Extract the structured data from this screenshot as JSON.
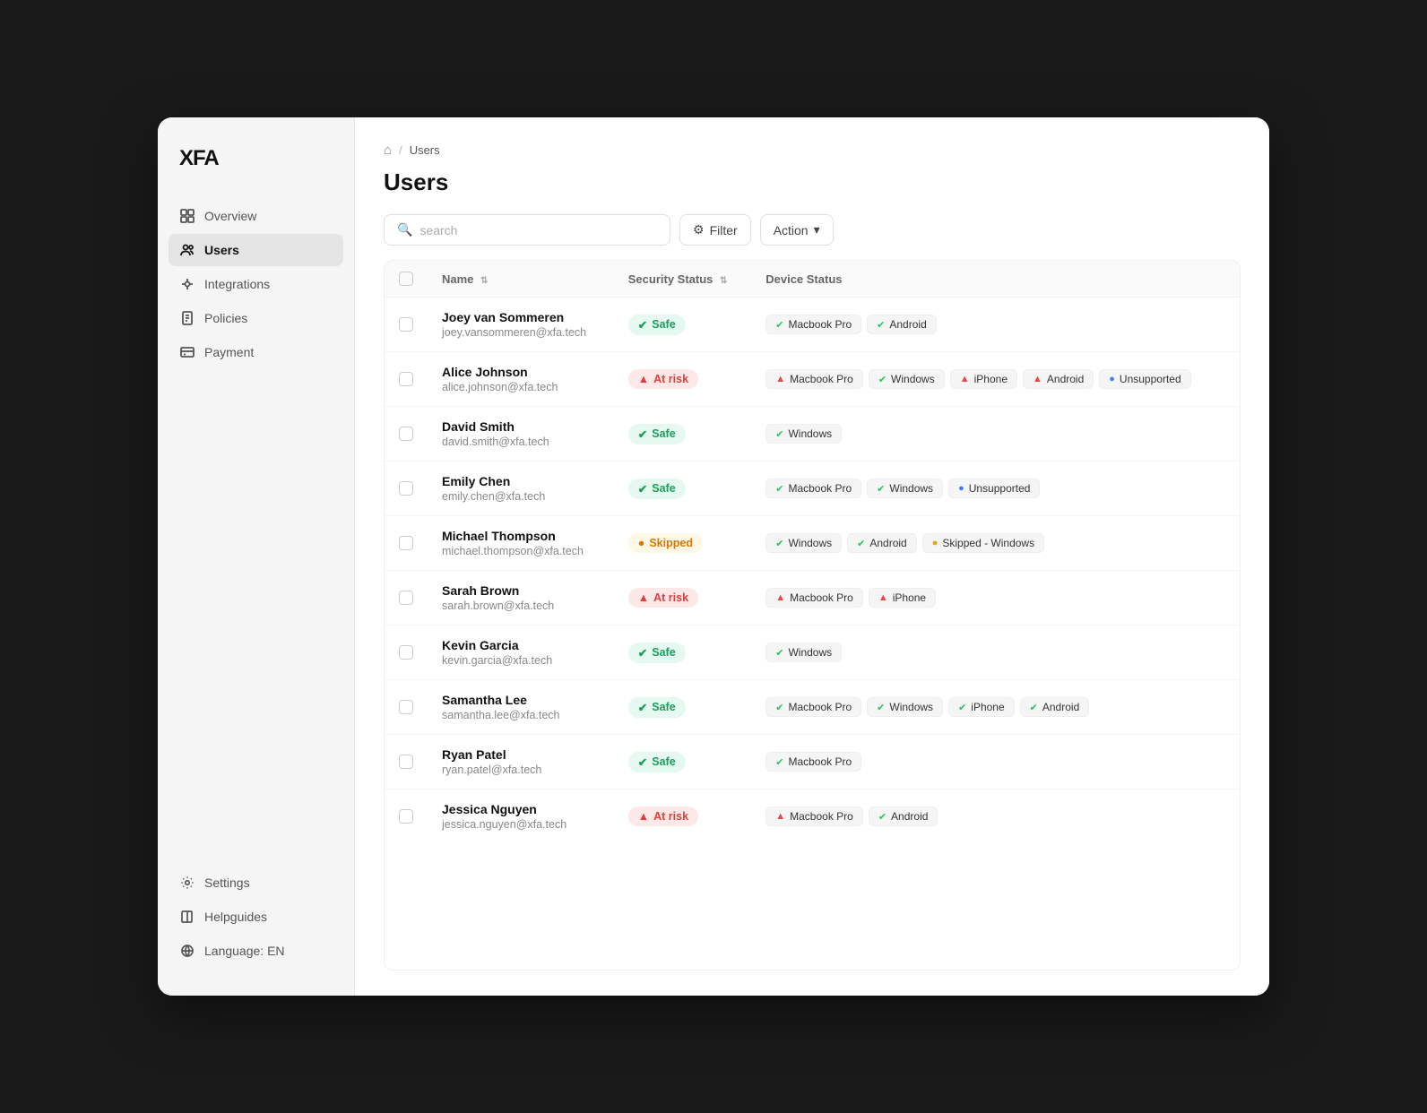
{
  "app": {
    "logo": "XFA"
  },
  "sidebar": {
    "nav_items": [
      {
        "id": "overview",
        "label": "Overview",
        "icon": "grid"
      },
      {
        "id": "users",
        "label": "Users",
        "icon": "users",
        "active": true
      },
      {
        "id": "integrations",
        "label": "Integrations",
        "icon": "integrations"
      },
      {
        "id": "policies",
        "label": "Policies",
        "icon": "policies"
      },
      {
        "id": "payment",
        "label": "Payment",
        "icon": "payment"
      }
    ],
    "bottom_items": [
      {
        "id": "settings",
        "label": "Settings",
        "icon": "settings"
      },
      {
        "id": "helpguides",
        "label": "Helpguides",
        "icon": "book"
      },
      {
        "id": "language",
        "label": "Language: EN",
        "icon": "language"
      }
    ]
  },
  "breadcrumb": {
    "home": "home",
    "separator": "/",
    "current": "Users"
  },
  "page": {
    "title": "Users"
  },
  "toolbar": {
    "search_placeholder": "search",
    "filter_label": "Filter",
    "action_label": "Action"
  },
  "table": {
    "columns": [
      "Name",
      "Security Status",
      "Device Status"
    ],
    "rows": [
      {
        "name": "Joey van Sommeren",
        "email": "joey.vansommeren@xfa.tech",
        "security_status": "Safe",
        "security_type": "safe",
        "devices": [
          {
            "label": "Macbook Pro",
            "status": "safe"
          },
          {
            "label": "Android",
            "status": "safe"
          }
        ]
      },
      {
        "name": "Alice Johnson",
        "email": "alice.johnson@xfa.tech",
        "security_status": "At risk",
        "security_type": "at-risk",
        "devices": [
          {
            "label": "Macbook Pro",
            "status": "risk"
          },
          {
            "label": "Windows",
            "status": "safe"
          },
          {
            "label": "iPhone",
            "status": "risk"
          },
          {
            "label": "Android",
            "status": "risk"
          },
          {
            "label": "Unsupported",
            "status": "unsupported"
          }
        ]
      },
      {
        "name": "David Smith",
        "email": "david.smith@xfa.tech",
        "security_status": "Safe",
        "security_type": "safe",
        "devices": [
          {
            "label": "Windows",
            "status": "safe"
          }
        ]
      },
      {
        "name": "Emily Chen",
        "email": "emily.chen@xfa.tech",
        "security_status": "Safe",
        "security_type": "safe",
        "devices": [
          {
            "label": "Macbook Pro",
            "status": "safe"
          },
          {
            "label": "Windows",
            "status": "safe"
          },
          {
            "label": "Unsupported",
            "status": "unsupported"
          }
        ]
      },
      {
        "name": "Michael Thompson",
        "email": "michael.thompson@xfa.tech",
        "security_status": "Skipped",
        "security_type": "skipped",
        "devices": [
          {
            "label": "Windows",
            "status": "safe"
          },
          {
            "label": "Android",
            "status": "safe"
          },
          {
            "label": "Skipped - Windows",
            "status": "skipped"
          }
        ]
      },
      {
        "name": "Sarah Brown",
        "email": "sarah.brown@xfa.tech",
        "security_status": "At risk",
        "security_type": "at-risk",
        "devices": [
          {
            "label": "Macbook Pro",
            "status": "risk"
          },
          {
            "label": "iPhone",
            "status": "risk"
          }
        ]
      },
      {
        "name": "Kevin Garcia",
        "email": "kevin.garcia@xfa.tech",
        "security_status": "Safe",
        "security_type": "safe",
        "devices": [
          {
            "label": "Windows",
            "status": "safe"
          }
        ]
      },
      {
        "name": "Samantha Lee",
        "email": "samantha.lee@xfa.tech",
        "security_status": "Safe",
        "security_type": "safe",
        "devices": [
          {
            "label": "Macbook Pro",
            "status": "safe"
          },
          {
            "label": "Windows",
            "status": "safe"
          },
          {
            "label": "iPhone",
            "status": "safe"
          },
          {
            "label": "Android",
            "status": "safe"
          }
        ]
      },
      {
        "name": "Ryan Patel",
        "email": "ryan.patel@xfa.tech",
        "security_status": "Safe",
        "security_type": "safe",
        "devices": [
          {
            "label": "Macbook Pro",
            "status": "safe"
          }
        ]
      },
      {
        "name": "Jessica Nguyen",
        "email": "jessica.nguyen@xfa.tech",
        "security_status": "At risk",
        "security_type": "at-risk",
        "devices": [
          {
            "label": "Macbook Pro",
            "status": "risk"
          },
          {
            "label": "Android",
            "status": "safe"
          }
        ]
      }
    ]
  }
}
